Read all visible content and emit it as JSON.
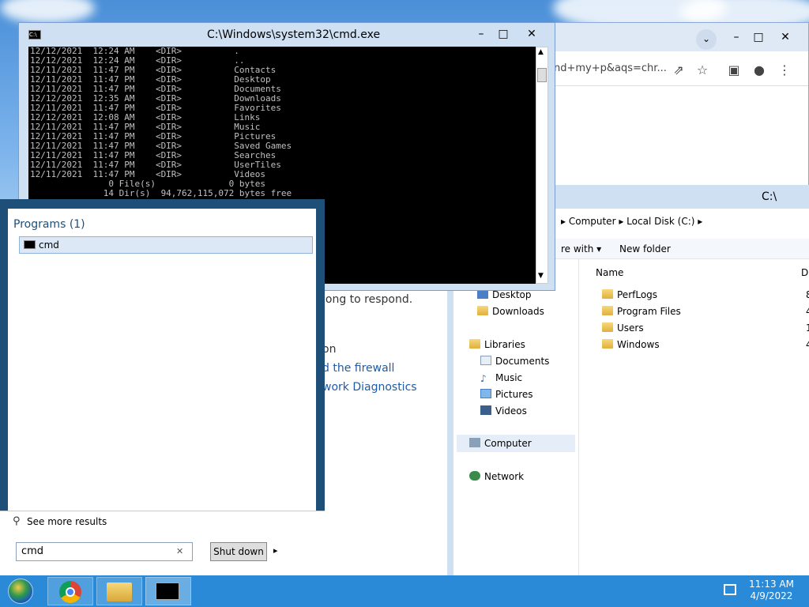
{
  "cmd": {
    "title": "C:\\Windows\\system32\\cmd.exe",
    "lines": [
      "12/12/2021  12:24 AM    <DIR>          .",
      "12/12/2021  12:24 AM    <DIR>          ..",
      "12/11/2021  11:47 PM    <DIR>          Contacts",
      "12/11/2021  11:47 PM    <DIR>          Desktop",
      "12/11/2021  11:47 PM    <DIR>          Documents",
      "12/12/2021  12:35 AM    <DIR>          Downloads",
      "12/11/2021  11:47 PM    <DIR>          Favorites",
      "12/12/2021  12:08 AM    <DIR>          Links",
      "12/11/2021  11:47 PM    <DIR>          Music",
      "12/11/2021  11:47 PM    <DIR>          Pictures",
      "12/11/2021  11:47 PM    <DIR>          Saved Games",
      "12/11/2021  11:47 PM    <DIR>          Searches",
      "12/11/2021  11:47 PM    <DIR>          UserTiles",
      "12/11/2021  11:47 PM    <DIR>          Videos",
      "               0 File(s)              0 bytes",
      "              14 Dir(s)  94,762,115,072 bytes free"
    ],
    "minimize": "–",
    "maximize": "□",
    "close": "✕"
  },
  "chrome": {
    "url_fragment": "nd+my+p&aqs=chr...",
    "minimize": "–",
    "maximize": "□",
    "close": "✕"
  },
  "explorer": {
    "title": "C:\\",
    "breadcrumb": [
      "Computer",
      "Local Disk (C:)"
    ],
    "commands": {
      "share_with": "re with",
      "new_folder": "New folder"
    },
    "column_name": "Name",
    "column_date": "Da",
    "nav": {
      "desktop": "Desktop",
      "downloads": "Downloads",
      "libraries": "Libraries",
      "documents": "Documents",
      "music": "Music",
      "pictures": "Pictures",
      "videos": "Videos",
      "computer": "Computer",
      "network": "Network"
    },
    "files": [
      {
        "name": "PerfLogs",
        "date": "8/"
      },
      {
        "name": "Program Files",
        "date": "4/"
      },
      {
        "name": "Users",
        "date": "12"
      },
      {
        "name": "Windows",
        "date": "4/"
      }
    ]
  },
  "control_panel": {
    "line1": "long to respond.",
    "line2": "on",
    "link1": "d the firewall",
    "link2": "work Diagnostics"
  },
  "start_menu": {
    "programs_header": "Programs (1)",
    "result": "cmd",
    "see_more": "See more results",
    "search_value": "cmd",
    "clear": "✕",
    "shutdown": "Shut down",
    "shutdown_arrow": "▸"
  },
  "taskbar": {
    "time": "11:13 AM",
    "date": "4/9/2022"
  },
  "colors": {
    "taskbar": "#2a8ad7",
    "start_border": "#1e4f78",
    "link": "#1e5ba8"
  }
}
